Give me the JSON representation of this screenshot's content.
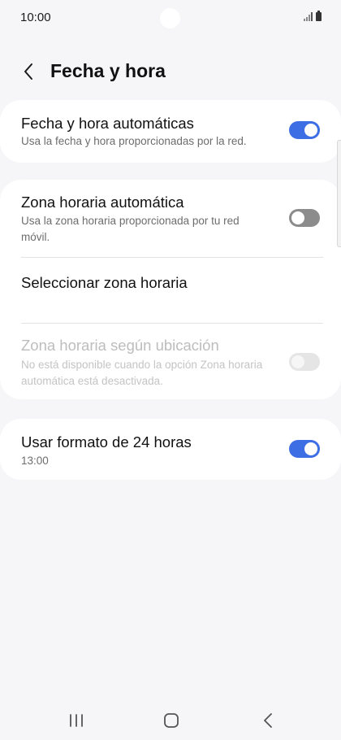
{
  "status_bar": {
    "time": "10:00",
    "icons": [
      "signal-icon",
      "battery-icon"
    ]
  },
  "header": {
    "back_icon": "chevron-left-icon",
    "title": "Fecha y hora"
  },
  "sections": {
    "auto_datetime": {
      "title": "Fecha y hora automáticas",
      "subtitle": "Usa la fecha y hora proporcionadas por la red.",
      "toggle": "on"
    },
    "auto_timezone": {
      "title": "Zona horaria automática",
      "subtitle": "Usa la zona horaria proporcionada por tu red móvil.",
      "toggle": "off"
    },
    "select_timezone": {
      "title": "Seleccionar zona horaria"
    },
    "location_timezone": {
      "title": "Zona horaria según ubicación",
      "subtitle": "No está disponible cuando la opción Zona horaria automática está desactivada.",
      "toggle": "off",
      "enabled": false
    },
    "format_24h": {
      "title": "Usar formato de 24 horas",
      "subtitle": "13:00",
      "toggle": "on"
    }
  },
  "colors": {
    "accent": "#3e6ee4",
    "background": "#f6f6f8",
    "card": "#ffffff",
    "toggle_off": "#8c8c8c",
    "disabled_text": "#bdbdbd"
  },
  "nav_bar": {
    "icons": [
      "recent-apps-icon",
      "home-icon",
      "back-icon"
    ]
  }
}
